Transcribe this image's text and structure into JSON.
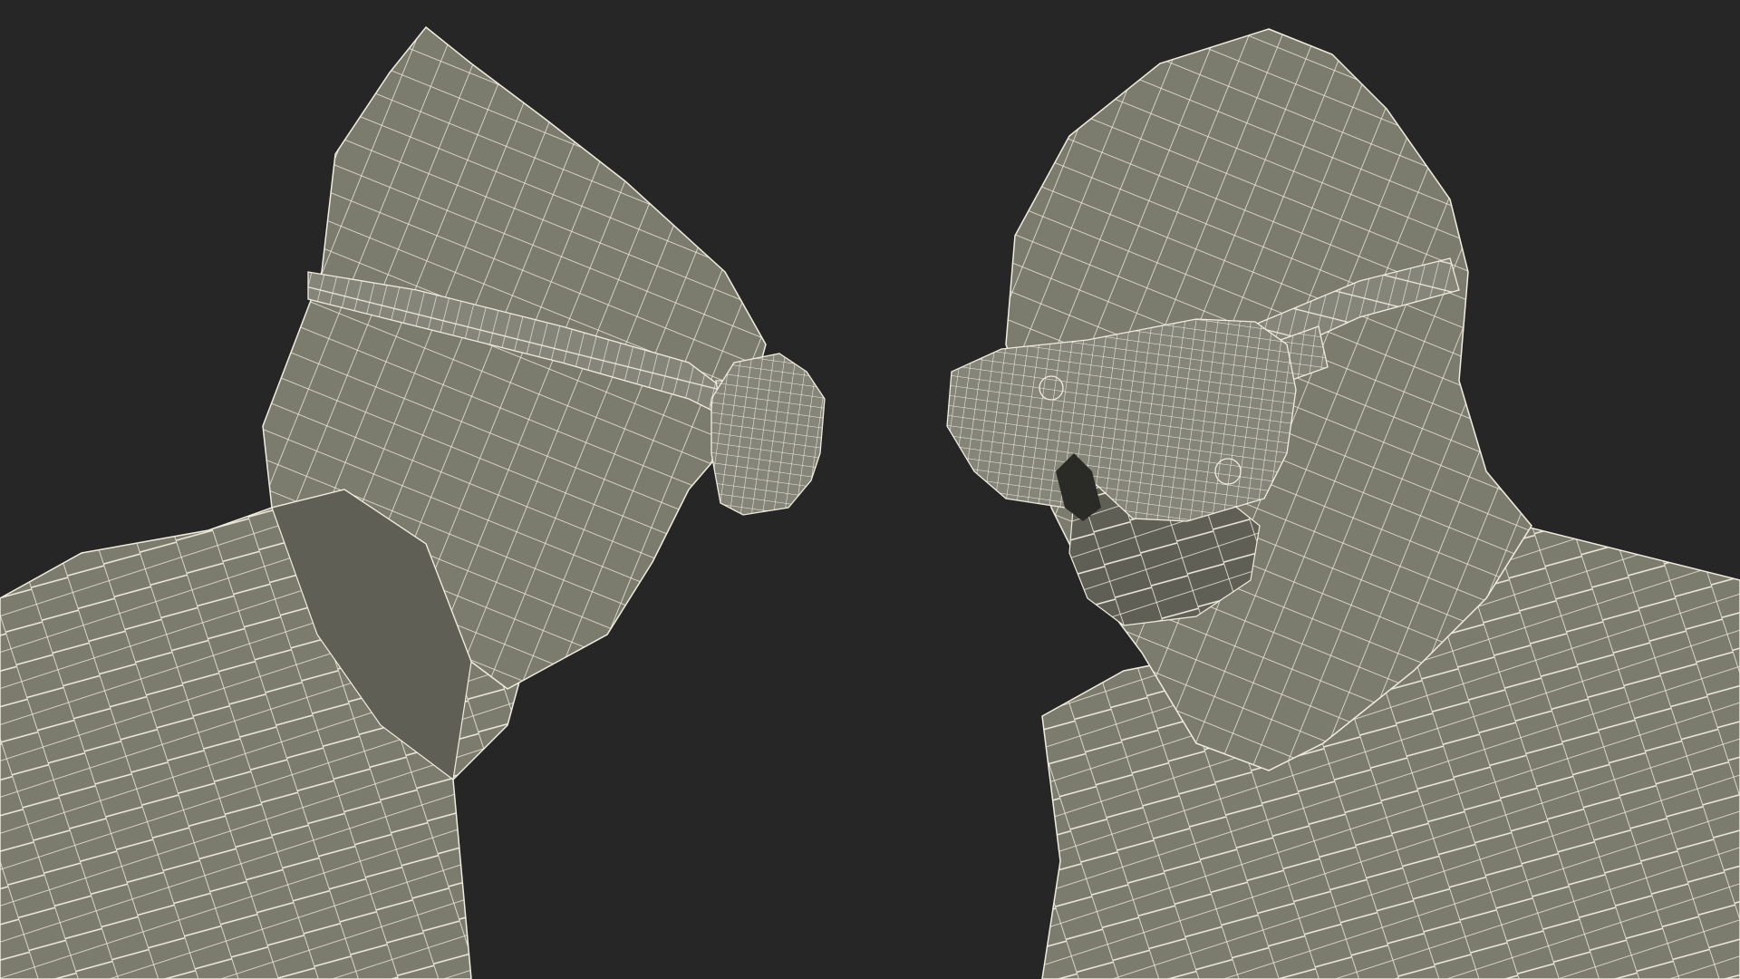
{
  "scene": {
    "subjects": [
      {
        "name": "left-figure",
        "facing": "right"
      },
      {
        "name": "right-figure",
        "facing": "left"
      }
    ],
    "background_color": "#262626",
    "mesh_fill_color": "#7b7b6e",
    "mesh_shadow_color": "#5f5f55",
    "wire_color": "#f0ede0",
    "strap_fill_color": "#85857a"
  }
}
